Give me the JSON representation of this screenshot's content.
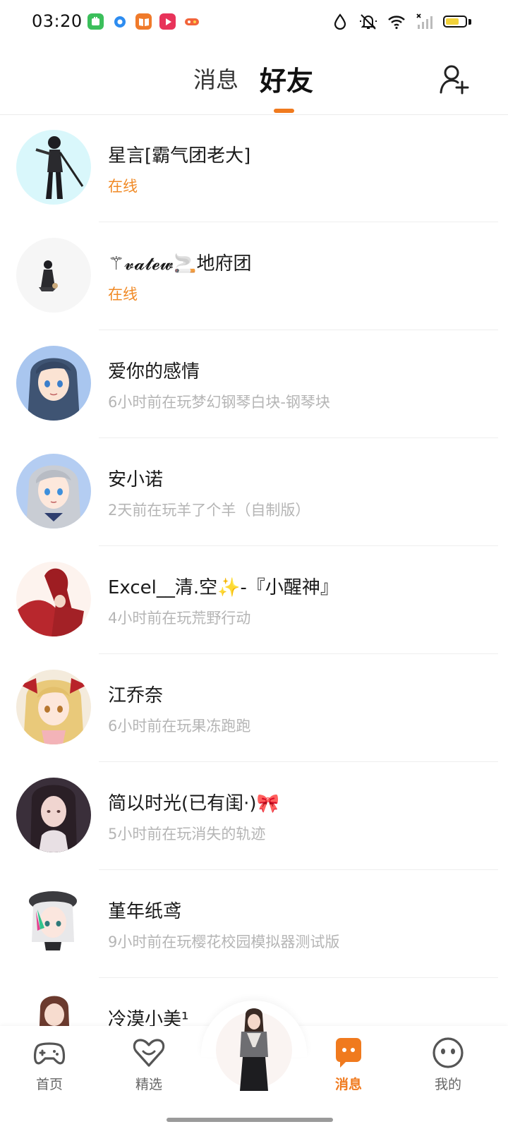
{
  "status_bar": {
    "time": "03:20",
    "app_icons": [
      "wechat-mini-icon",
      "browser-icon",
      "book-icon",
      "video-icon",
      "game-icon"
    ],
    "system_icons": [
      "drop-icon",
      "mute-icon",
      "wifi-icon",
      "signal-icon",
      "battery-icon"
    ]
  },
  "header": {
    "tabs": [
      {
        "label": "消息",
        "active": false
      },
      {
        "label": "好友",
        "active": true
      }
    ],
    "accent_color": "#f07a1e"
  },
  "friends": [
    {
      "name": "星言[霸气团老大]",
      "status": "在线",
      "online": true
    },
    {
      "name": "⚚𝓿𝓪𝓽𝓮𝔀🚬地府团",
      "status": "在线",
      "online": true
    },
    {
      "name": "爱你的感情",
      "status": "6小时前在玩梦幻钢琴白块-钢琴块",
      "online": false
    },
    {
      "name": "安小诺",
      "status": "2天前在玩羊了个羊（自制版）",
      "online": false
    },
    {
      "name": "Excel__清.空✨-『小醒神』",
      "status": "4小时前在玩荒野行动",
      "online": false
    },
    {
      "name": "江乔奈",
      "status": "6小时前在玩果冻跑跑",
      "online": false
    },
    {
      "name": "简以时光(已有闺·)🎀",
      "status": "5小时前在玩消失的轨迹",
      "online": false
    },
    {
      "name": "堇年纸鸢",
      "status": "9小时前在玩樱花校园模拟器测试版",
      "online": false
    },
    {
      "name": "冷漠小美¹",
      "status": "",
      "online": false
    }
  ],
  "bottom_nav": {
    "items": [
      {
        "label": "首页",
        "icon": "gamepad-icon",
        "active": false
      },
      {
        "label": "精选",
        "icon": "heart-icon",
        "active": false
      },
      {
        "label": "消息",
        "icon": "chat-bubble-icon",
        "active": true
      },
      {
        "label": "我的",
        "icon": "smiley-icon",
        "active": false
      }
    ],
    "center_icon": "avatar"
  }
}
